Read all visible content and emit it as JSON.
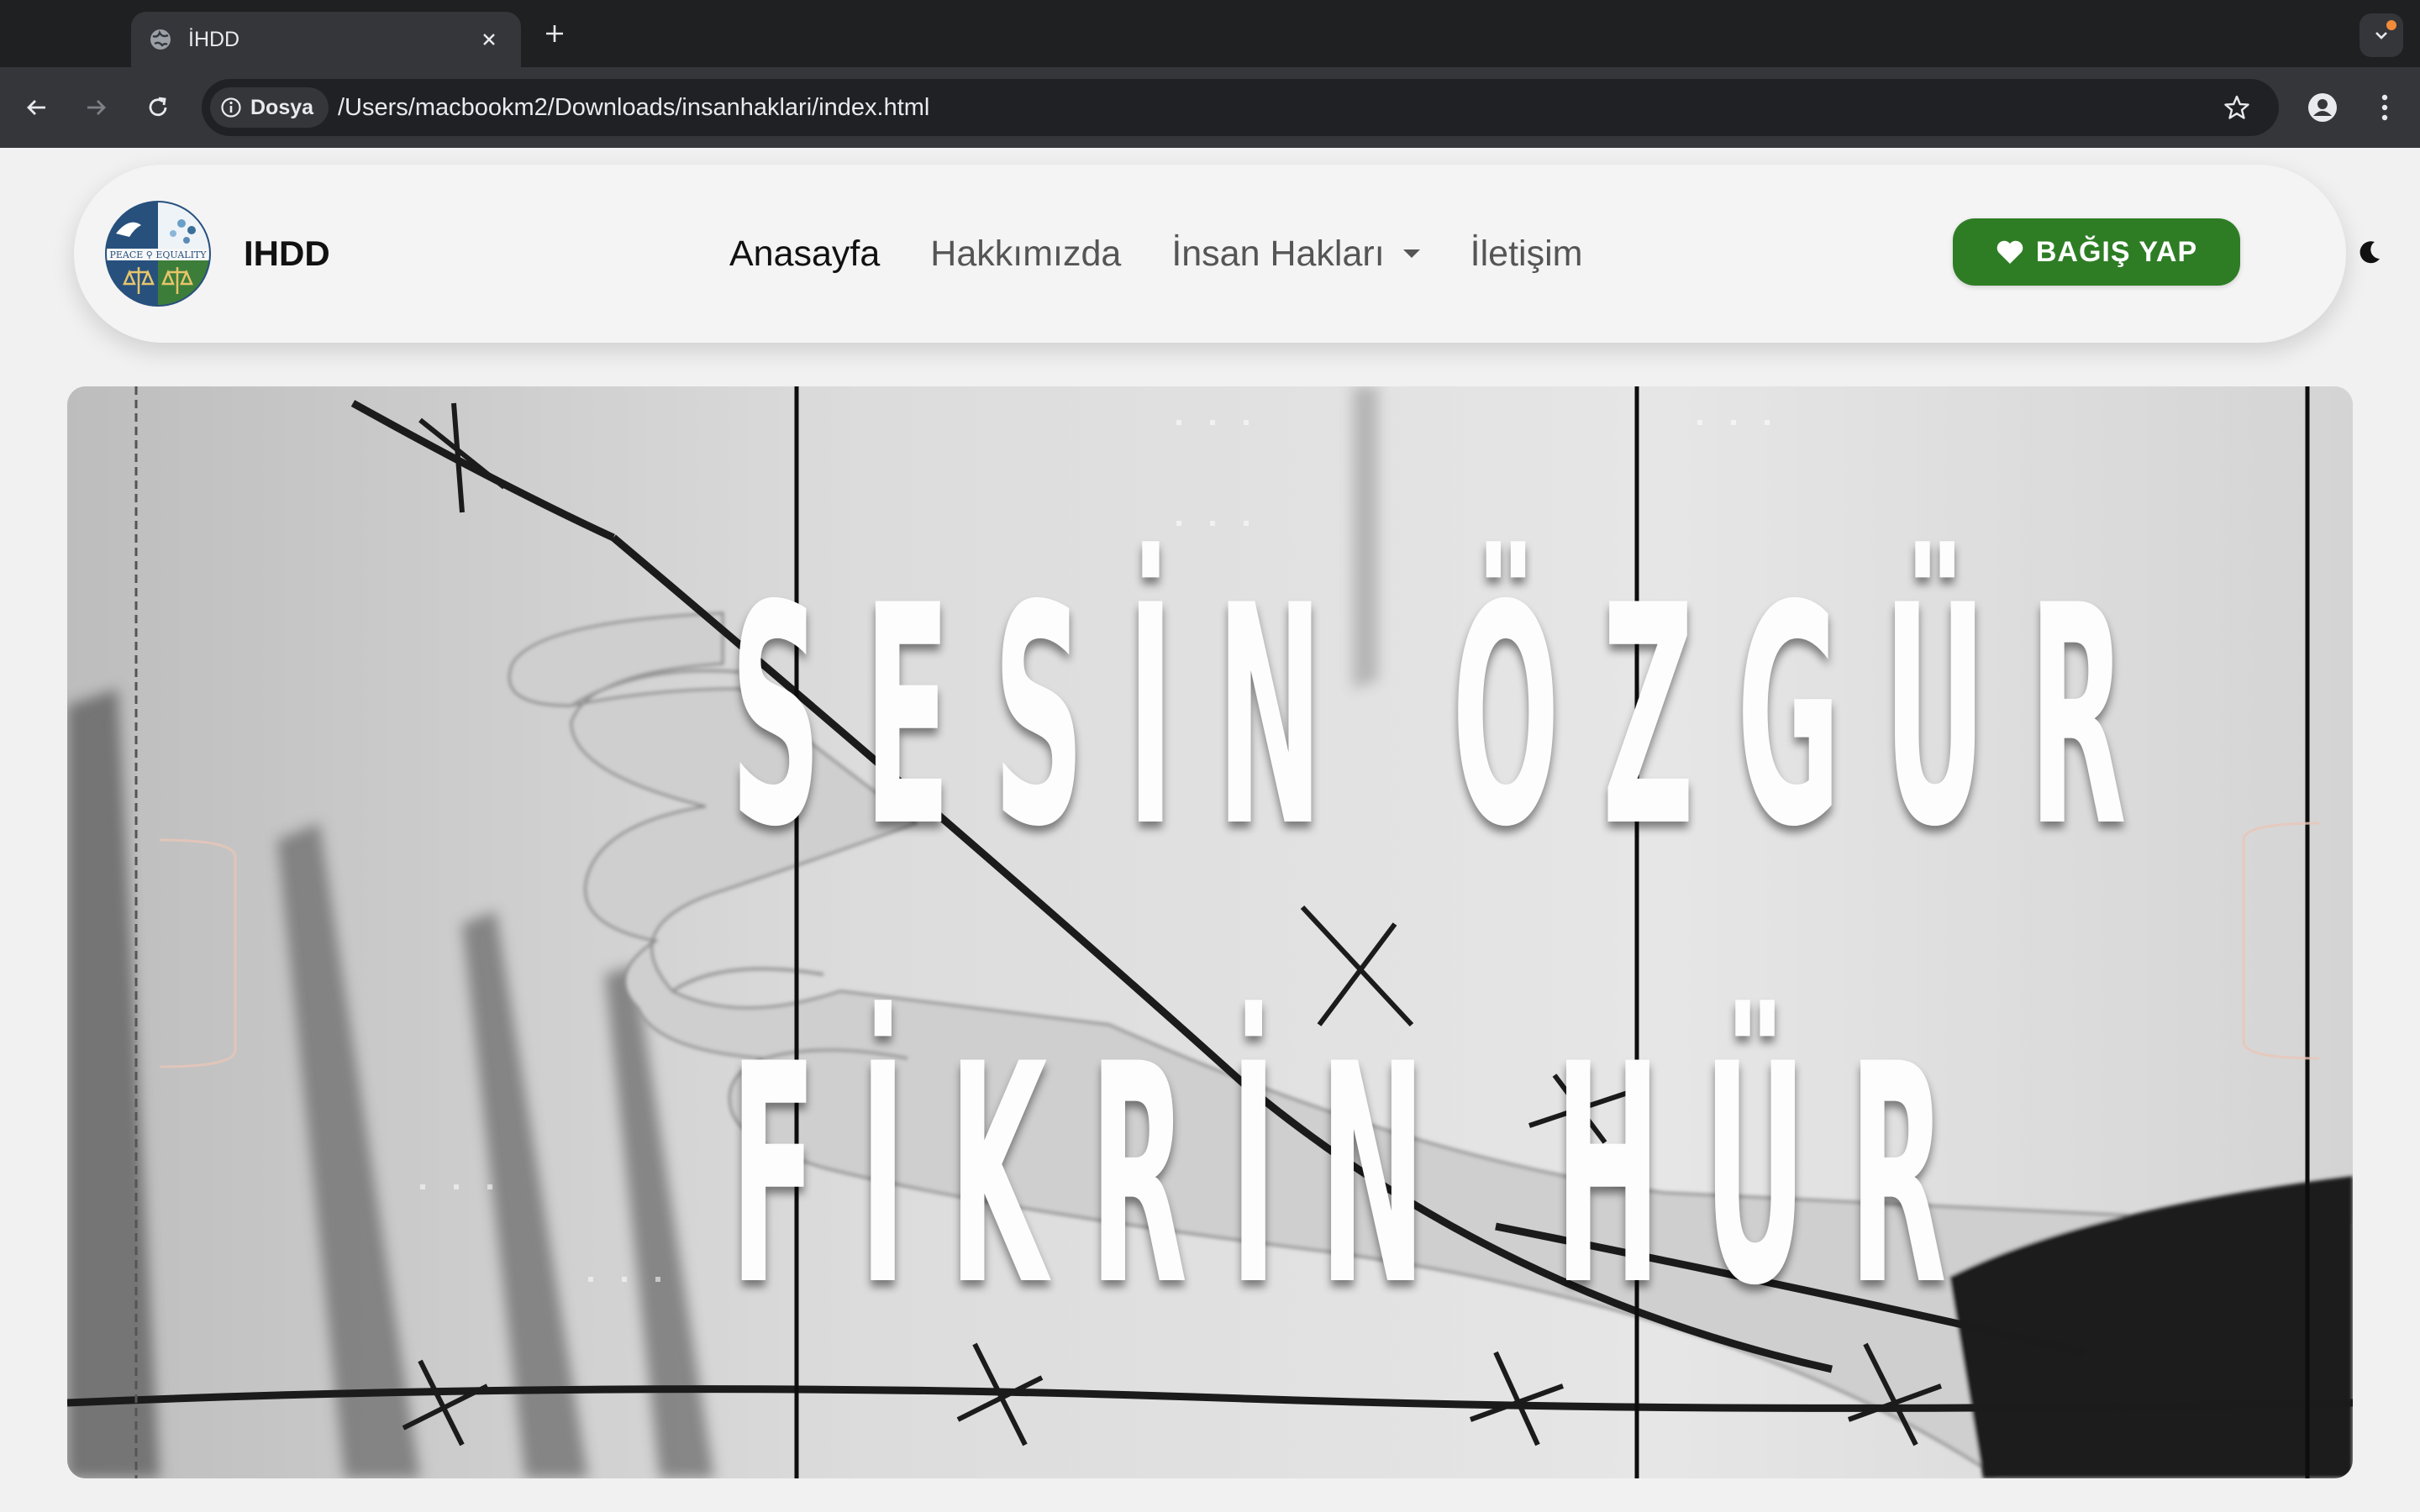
{
  "browser": {
    "tab": {
      "title": "İHDD",
      "favicon": "globe-icon",
      "close_icon": "close-icon"
    },
    "new_tab_icon": "plus-icon",
    "tab_search_icon": "chevron-down-icon",
    "nav": {
      "back_icon": "arrow-left-icon",
      "forward_icon": "arrow-right-icon",
      "reload_icon": "reload-icon"
    },
    "omnibox": {
      "security_chip": "Dosya",
      "security_icon": "info-icon",
      "url": "/Users/macbookm2/Downloads/insanhaklari/index.html",
      "bookmark_icon": "star-icon"
    },
    "profile_icon": "person-icon",
    "menu_icon": "kebab-icon"
  },
  "navbar": {
    "brand": "IHDD",
    "logo_text": "PEACE EQUALITY",
    "items": [
      {
        "label": "Anasayfa",
        "active": true
      },
      {
        "label": "Hakkımızda",
        "active": false
      },
      {
        "label": "İnsan Hakları",
        "active": false,
        "dropdown": true
      },
      {
        "label": "İletişim",
        "active": false
      }
    ],
    "donate_label": "BAĞIŞ YAP",
    "donate_icon": "heart-icon",
    "theme_icon": "moon-icon",
    "colors": {
      "donate": "#2e7d25",
      "navbar_bg": "#f4f4f4"
    }
  },
  "hero": {
    "line1": "SESİN ÖZGÜR",
    "line2": "FİKRİN HÜR",
    "image": "grayscale hand holding barbed wire"
  }
}
